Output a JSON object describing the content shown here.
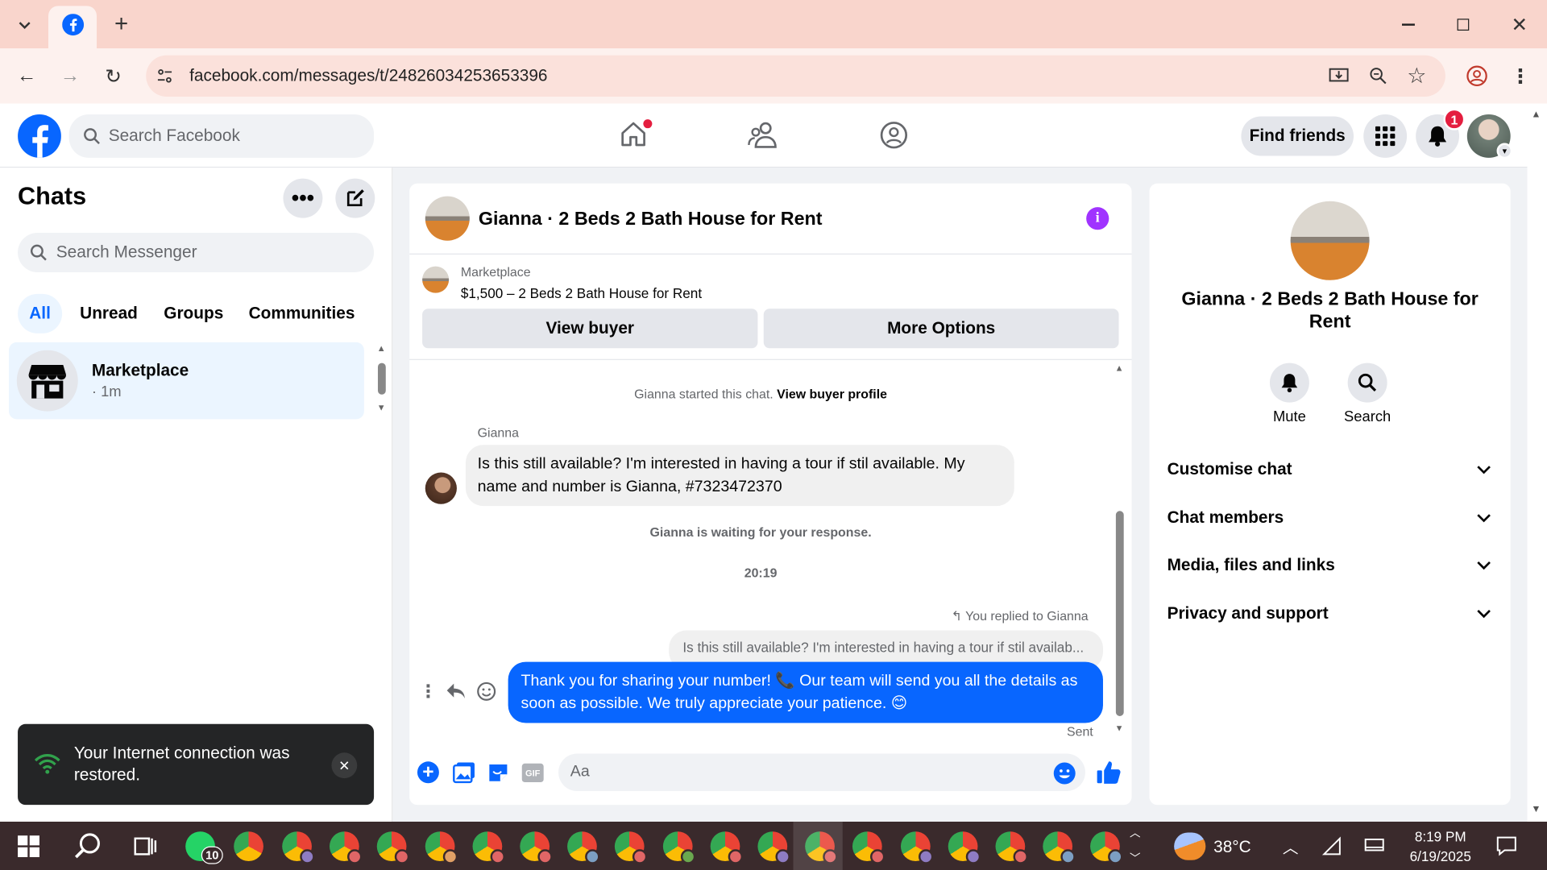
{
  "browser": {
    "url": "facebook.com/messages/t/24826034253653396"
  },
  "fb": {
    "search_placeholder": "Search Facebook",
    "find_friends": "Find friends",
    "notif_count": "1"
  },
  "chats": {
    "title": "Chats",
    "search_placeholder": "Search Messenger",
    "filters": [
      "All",
      "Unread",
      "Groups",
      "Communities"
    ],
    "item": {
      "name": "Marketplace",
      "time": "· 1m"
    }
  },
  "toast": {
    "text": "Your Internet connection was restored."
  },
  "thread": {
    "title": "Gianna · 2 Beds 2 Bath House for Rent",
    "listing_source": "Marketplace",
    "listing_title": "$1,500 – 2 Beds 2 Bath House for Rent",
    "view_buyer": "View buyer",
    "more_options": "More Options",
    "started_text": "Gianna started this chat.",
    "view_profile": "View buyer profile",
    "sender": "Gianna",
    "incoming": "Is this still available? I'm interested in having a tour if stil available. My name and number is Gianna, #7323472370",
    "waiting": "Gianna is waiting for your response.",
    "time": "20:19",
    "replied_to": "You replied to Gianna",
    "quoted": "Is this still available? I'm interested in having a tour if stil availab...",
    "outgoing": "Thank you for sharing your number! 📞 Our team will send you all the details as soon as possible. We truly appreciate your patience. 😊",
    "sent": "Sent",
    "composer_placeholder": "Aa"
  },
  "info": {
    "title": "Gianna · 2 Beds 2 Bath House for Rent",
    "mute": "Mute",
    "search": "Search",
    "sections": [
      "Customise chat",
      "Chat members",
      "Media, files and links",
      "Privacy and support"
    ]
  },
  "taskbar": {
    "whatsapp_badge": "10",
    "weather": "38°C",
    "time": "8:19 PM",
    "date": "6/19/2025"
  },
  "colors": {
    "fb_blue": "#0866ff",
    "chrome_tab": "#f9d5cc",
    "taskbar": "#3a2a2c"
  }
}
